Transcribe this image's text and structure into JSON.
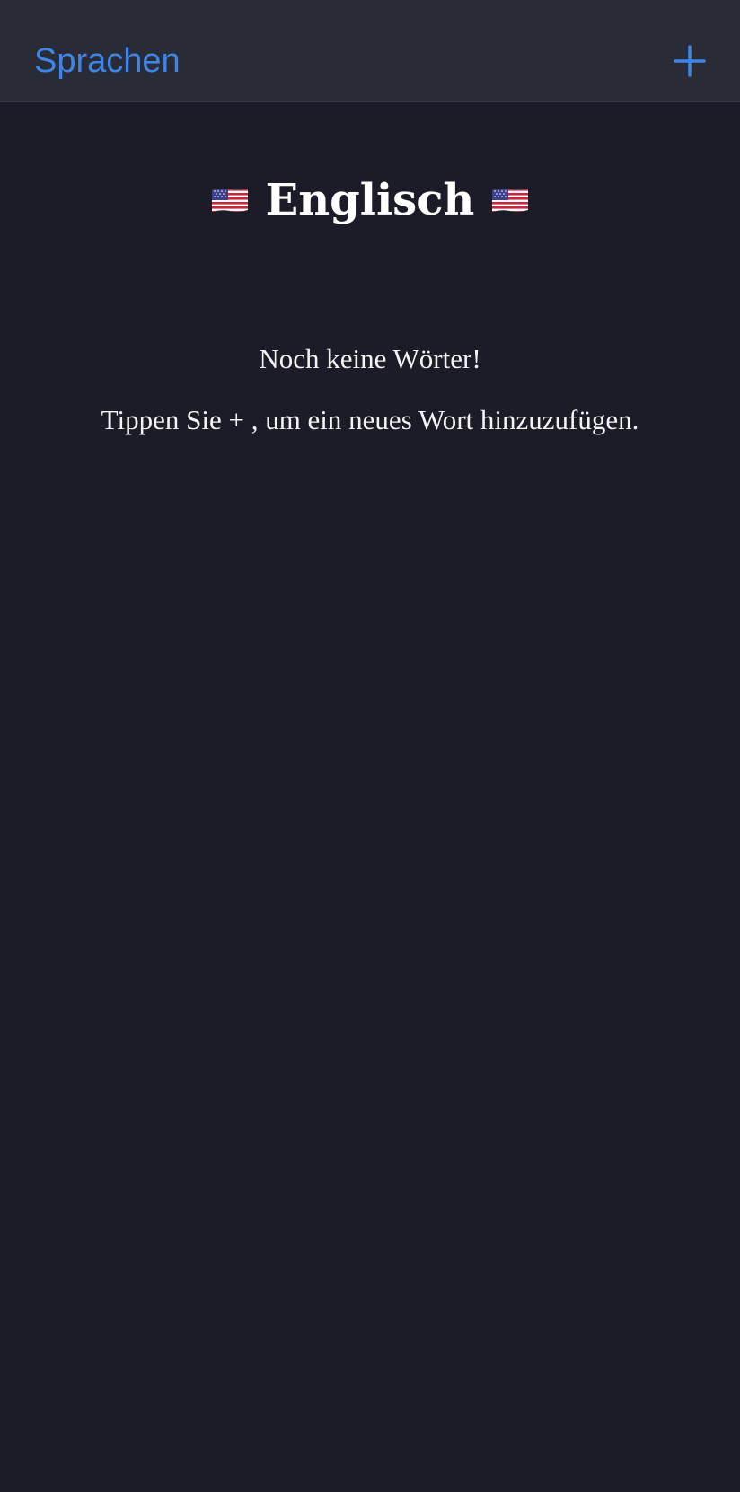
{
  "navbar": {
    "back_label": "Sprachen",
    "add_icon": "plus-icon",
    "accent_color": "#3e85e6"
  },
  "main": {
    "flag_icon": "us-flag-icon",
    "title": "Englisch",
    "empty_title": "Noch keine Wörter!",
    "empty_hint": "Tippen Sie + , um ein neues Wort hinzuzufügen."
  },
  "colors": {
    "background": "#1b1c27",
    "navbar_background": "#292b37",
    "text": "#ffffff"
  }
}
